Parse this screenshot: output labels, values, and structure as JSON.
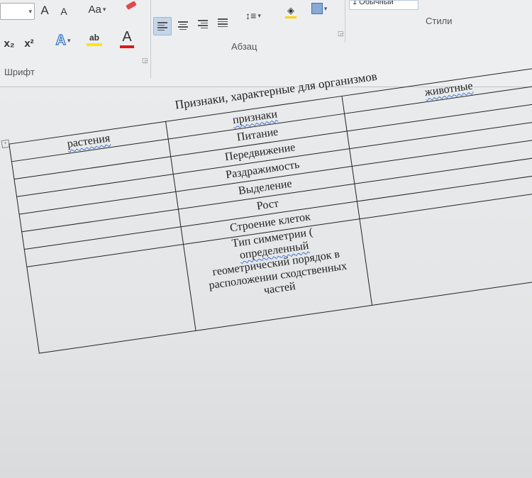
{
  "ribbon": {
    "font_group": {
      "label": "Шрифт",
      "grow_font": "A",
      "shrink_font": "A",
      "change_case": "Aa",
      "subscript": "x₂",
      "superscript": "x²",
      "text_effects": "A",
      "highlight": "ab",
      "font_color": "A"
    },
    "paragraph_group": {
      "label": "Абзац"
    },
    "styles_group": {
      "label": "Стили",
      "style_preview": "1 Обычный"
    }
  },
  "document": {
    "title": "Признаки, характерные для организмов",
    "headers": [
      "растения",
      "признаки",
      "животные"
    ],
    "rows": [
      [
        "",
        "Питание",
        ""
      ],
      [
        "",
        "Передвижение",
        ""
      ],
      [
        "",
        "Раздражимость",
        ""
      ],
      [
        "",
        "Выделение",
        ""
      ],
      [
        "",
        "Рост",
        ""
      ],
      [
        "",
        "Строение клеток",
        ""
      ]
    ],
    "last_row": {
      "line1": "Тип симметрии (",
      "line2": "определенный",
      "line3": "геометрический порядок  в",
      "line4": "расположении сходственных",
      "line5": "частей"
    }
  },
  "colors": {
    "accent": "#2b579a",
    "highlight": "#ffe600",
    "font_color": "#d81b1b",
    "spellcheck": "#3a6fd0"
  }
}
